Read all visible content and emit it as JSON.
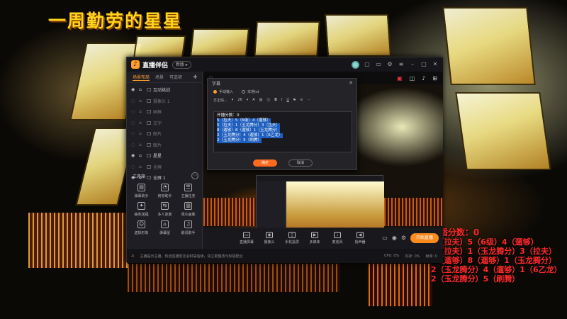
{
  "stream_title": "一周勤劳的星星",
  "overlay_score": {
    "lines": [
      "开播分数：0",
      "5（拉夫）5（6级）4（遛够）",
      "5（拉夫）1（玉龙腾分）3（拉夫）",
      "8（遛够）8（遛够）1（玉龙腾分）",
      "2（玉龙腾分）4（遛够）1（6乙龙）",
      "2（玉龙腾分）5（刷腾）"
    ],
    "color": "#ff2a2a"
  },
  "app": {
    "logo_text": "直播伴侣",
    "version_badge": "新版 ▸",
    "sidebar_tabs": [
      "场景布局",
      "场景",
      "可选项"
    ],
    "scenes": [
      {
        "label": "互动挑战"
      },
      {
        "label": "摄像头 1"
      },
      {
        "label": "画框"
      },
      {
        "label": "文字"
      },
      {
        "label": "图片"
      },
      {
        "label": "图片"
      },
      {
        "label": "星星"
      },
      {
        "label": "全屏"
      },
      {
        "label": "全屏 1"
      }
    ],
    "toolbox_title": "工具箱",
    "tools": [
      "弹幕助手",
      "房管助手",
      "主播任务",
      "抽奖送福",
      "多人连麦",
      "观众画像",
      "虚拟形象",
      "弹幕屋",
      "歌词助手"
    ],
    "actions": [
      "直播屏幕",
      "摄像头",
      "手机投屏",
      "多媒体",
      "麦克风",
      "扬声器"
    ],
    "start_live_label": "开始直播",
    "status_warning": "主播提示主播，知道直播暂定会封禁后续，请立即整改与积极配合",
    "status_stats": [
      "CPU: 0%",
      "内存: 0%",
      "帧率: 0"
    ]
  },
  "dialog": {
    "title": "字幕",
    "radio_manual": "手动输入",
    "radio_local": "本地txt",
    "font_name": "方正综...",
    "font_size": "26",
    "text_lines": [
      "开播分数：0",
      "5（拉夫）5（6级）4（遛够）",
      "5（拉夫）1（玉龙腾分）3（拉夫）",
      "8（遛够）8（遛够）1（玉龙腾分）",
      "2（玉龙腾分）4（遛够）1（6乙龙）",
      "2（玉龙腾分）5（刷腾）"
    ],
    "ok_label": "确定",
    "cancel_label": "取消"
  },
  "colors": {
    "accent": "#ff9d2e",
    "title_yellow": "#ffd21c",
    "selection": "#1f5fbf"
  }
}
